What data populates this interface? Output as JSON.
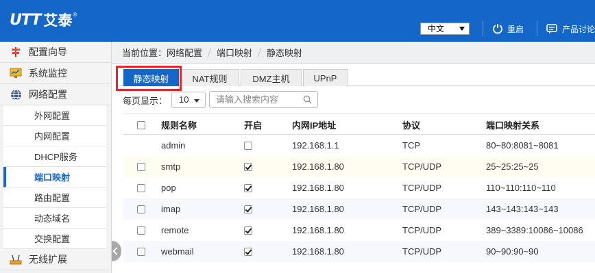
{
  "header": {
    "logo_mark": "UTT",
    "logo_text": "艾泰",
    "logo_reg": "®",
    "language": "中文",
    "restart_label": "重启",
    "forum_label": "产品讨论"
  },
  "sidebar": {
    "items": [
      {
        "label": "配置向导",
        "icon": "wizard-icon"
      },
      {
        "label": "系统监控",
        "icon": "monitor-icon"
      },
      {
        "label": "网络配置",
        "icon": "globe-icon"
      }
    ],
    "network_sub": [
      {
        "label": "外网配置"
      },
      {
        "label": "内网配置"
      },
      {
        "label": "DHCP服务"
      },
      {
        "label": "端口映射"
      },
      {
        "label": "路由配置"
      },
      {
        "label": "动态域名"
      },
      {
        "label": "交换配置"
      }
    ],
    "wireless": {
      "label": "无线扩展",
      "icon": "wireless-icon"
    }
  },
  "breadcrumb": {
    "prefix": "当前位置：",
    "items": [
      "网络配置",
      "端口映射",
      "静态映射"
    ]
  },
  "tabs": [
    {
      "label": "静态映射"
    },
    {
      "label": "NAT规则"
    },
    {
      "label": "DMZ主机"
    },
    {
      "label": "UPnP"
    }
  ],
  "toolbar": {
    "per_page_label": "每页显示：",
    "per_page_value": "10",
    "search_placeholder": "请输入搜索内容"
  },
  "table": {
    "headers": [
      "规则名称",
      "开启",
      "内网IP地址",
      "协议",
      "端口映射关系"
    ],
    "rows": [
      {
        "name": "admin",
        "enabled": false,
        "ip": "192.168.1.1",
        "protocol": "TCP",
        "mapping": "80~80:8081~8081"
      },
      {
        "name": "smtp",
        "enabled": true,
        "ip": "192.168.1.80",
        "protocol": "TCP/UDP",
        "mapping": "25~25:25~25"
      },
      {
        "name": "pop",
        "enabled": true,
        "ip": "192.168.1.80",
        "protocol": "TCP/UDP",
        "mapping": "110~110:110~110"
      },
      {
        "name": "imap",
        "enabled": true,
        "ip": "192.168.1.80",
        "protocol": "TCP/UDP",
        "mapping": "143~143:143~143"
      },
      {
        "name": "remote",
        "enabled": true,
        "ip": "192.168.1.80",
        "protocol": "TCP/UDP",
        "mapping": "389~3389:10086~10086"
      },
      {
        "name": "webmail",
        "enabled": true,
        "ip": "192.168.1.80",
        "protocol": "TCP/UDP",
        "mapping": "90~90:90~90"
      }
    ]
  },
  "colors": {
    "brand_blue": "#1466c9",
    "highlight_red": "#e8242c"
  }
}
